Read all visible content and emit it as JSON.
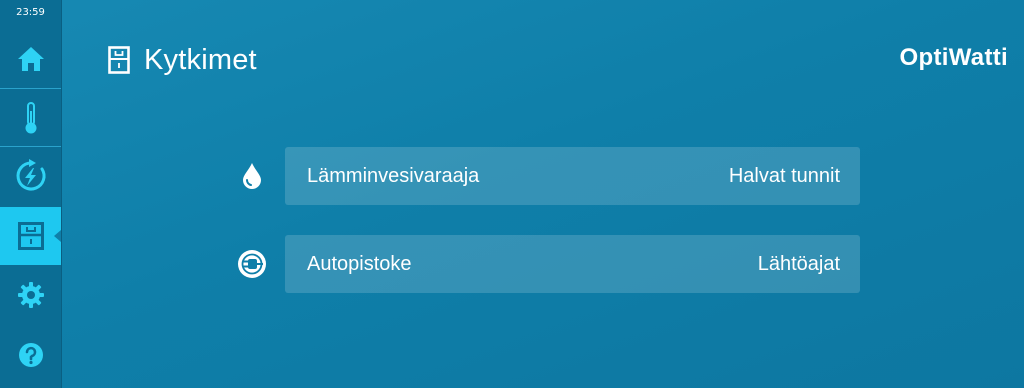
{
  "status_bar": {
    "time": "23:59"
  },
  "sidebar": {
    "items": [
      {
        "name": "home",
        "icon": "home-icon"
      },
      {
        "name": "temperature",
        "icon": "thermometer-icon"
      },
      {
        "name": "energy",
        "icon": "energy-bolt-icon"
      },
      {
        "name": "switches",
        "icon": "switch-icon",
        "active": true
      },
      {
        "name": "settings",
        "icon": "gear-icon"
      },
      {
        "name": "help",
        "icon": "help-icon"
      }
    ]
  },
  "header": {
    "title": "Kytkimet",
    "icon": "switch-icon",
    "brand": "OptiWatti"
  },
  "switches": [
    {
      "label": "Lämminvesivaraaja",
      "value": "Halvat tunnit",
      "icon": "water-drop-icon"
    },
    {
      "label": "Autopistoke",
      "value": "Lähtöajat",
      "icon": "plug-icon"
    }
  ],
  "colors": {
    "background": "#0f7fa9",
    "sidebar": "#0b6d94",
    "active_item": "#1ec8f0",
    "text": "#ffffff"
  }
}
